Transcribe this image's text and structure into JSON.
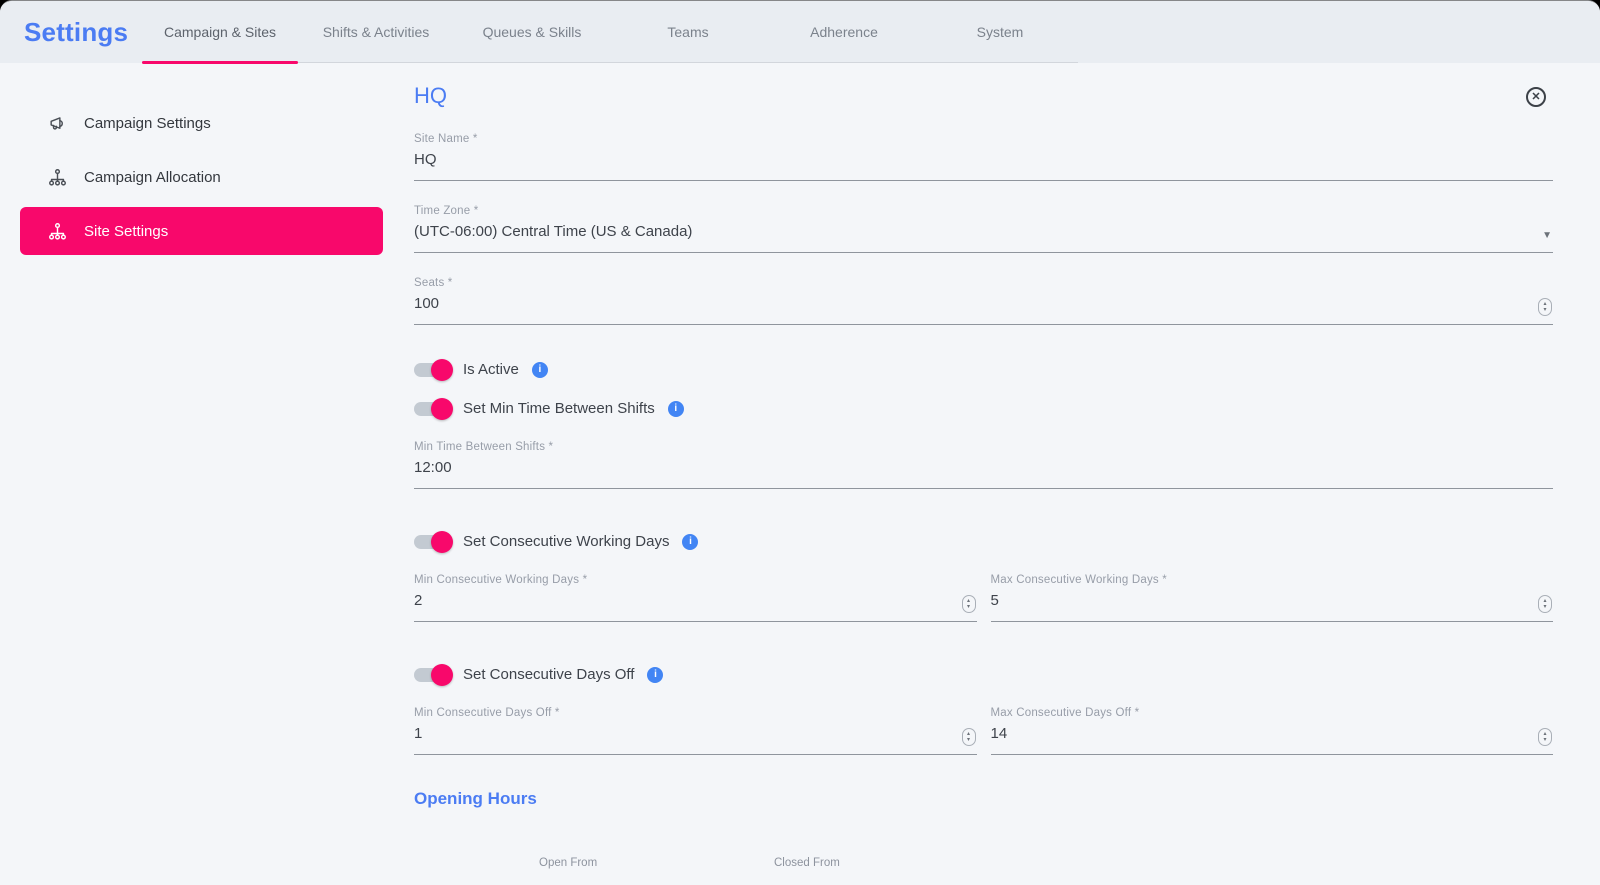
{
  "header": {
    "title": "Settings",
    "tabs": [
      {
        "label": "Campaign & Sites",
        "active": true
      },
      {
        "label": "Shifts & Activities",
        "active": false
      },
      {
        "label": "Queues & Skills",
        "active": false
      },
      {
        "label": "Teams",
        "active": false
      },
      {
        "label": "Adherence",
        "active": false
      },
      {
        "label": "System",
        "active": false
      }
    ]
  },
  "sidebar": {
    "items": [
      {
        "label": "Campaign Settings",
        "icon": "megaphone-icon",
        "active": false
      },
      {
        "label": "Campaign Allocation",
        "icon": "sitemap-icon",
        "active": false
      },
      {
        "label": "Site Settings",
        "icon": "sitemap-icon",
        "active": true
      }
    ]
  },
  "main": {
    "title": "HQ",
    "fields": {
      "site_name": {
        "label": "Site Name *",
        "value": "HQ"
      },
      "time_zone": {
        "label": "Time Zone *",
        "value": "(UTC-06:00) Central Time (US & Canada)"
      },
      "seats": {
        "label": "Seats *",
        "value": "100"
      },
      "min_time_between_shifts": {
        "label": "Min Time Between Shifts *",
        "value": "12:00"
      },
      "min_consecutive_working_days": {
        "label": "Min Consecutive Working Days *",
        "value": "2"
      },
      "max_consecutive_working_days": {
        "label": "Max Consecutive Working Days *",
        "value": "5"
      },
      "min_consecutive_days_off": {
        "label": "Min Consecutive Days Off *",
        "value": "1"
      },
      "max_consecutive_days_off": {
        "label": "Max Consecutive Days Off *",
        "value": "14"
      }
    },
    "toggles": [
      {
        "label": "Is Active",
        "on": true
      },
      {
        "label": "Set Min Time Between Shifts",
        "on": true
      },
      {
        "label": "Set Consecutive Working Days",
        "on": true
      },
      {
        "label": "Set Consecutive Days Off",
        "on": true
      }
    ],
    "opening_hours": {
      "title": "Opening Hours",
      "columns": {
        "open_from": "Open From",
        "closed_from": "Closed From"
      }
    }
  },
  "icons": {
    "close": "circle-x",
    "info": "i-circle",
    "dropdown": "caret-down",
    "number_stepper": "up-down-arrows",
    "campaign_settings": "megaphone",
    "campaign_allocation": "sitemap",
    "site_settings": "sitemap"
  },
  "colors": {
    "accent_pink": "#f8086b",
    "accent_blue": "#4b7cf3",
    "info_blue": "#4285f4",
    "header_bg": "#e9edf2",
    "content_bg": "#f4f6f9"
  }
}
